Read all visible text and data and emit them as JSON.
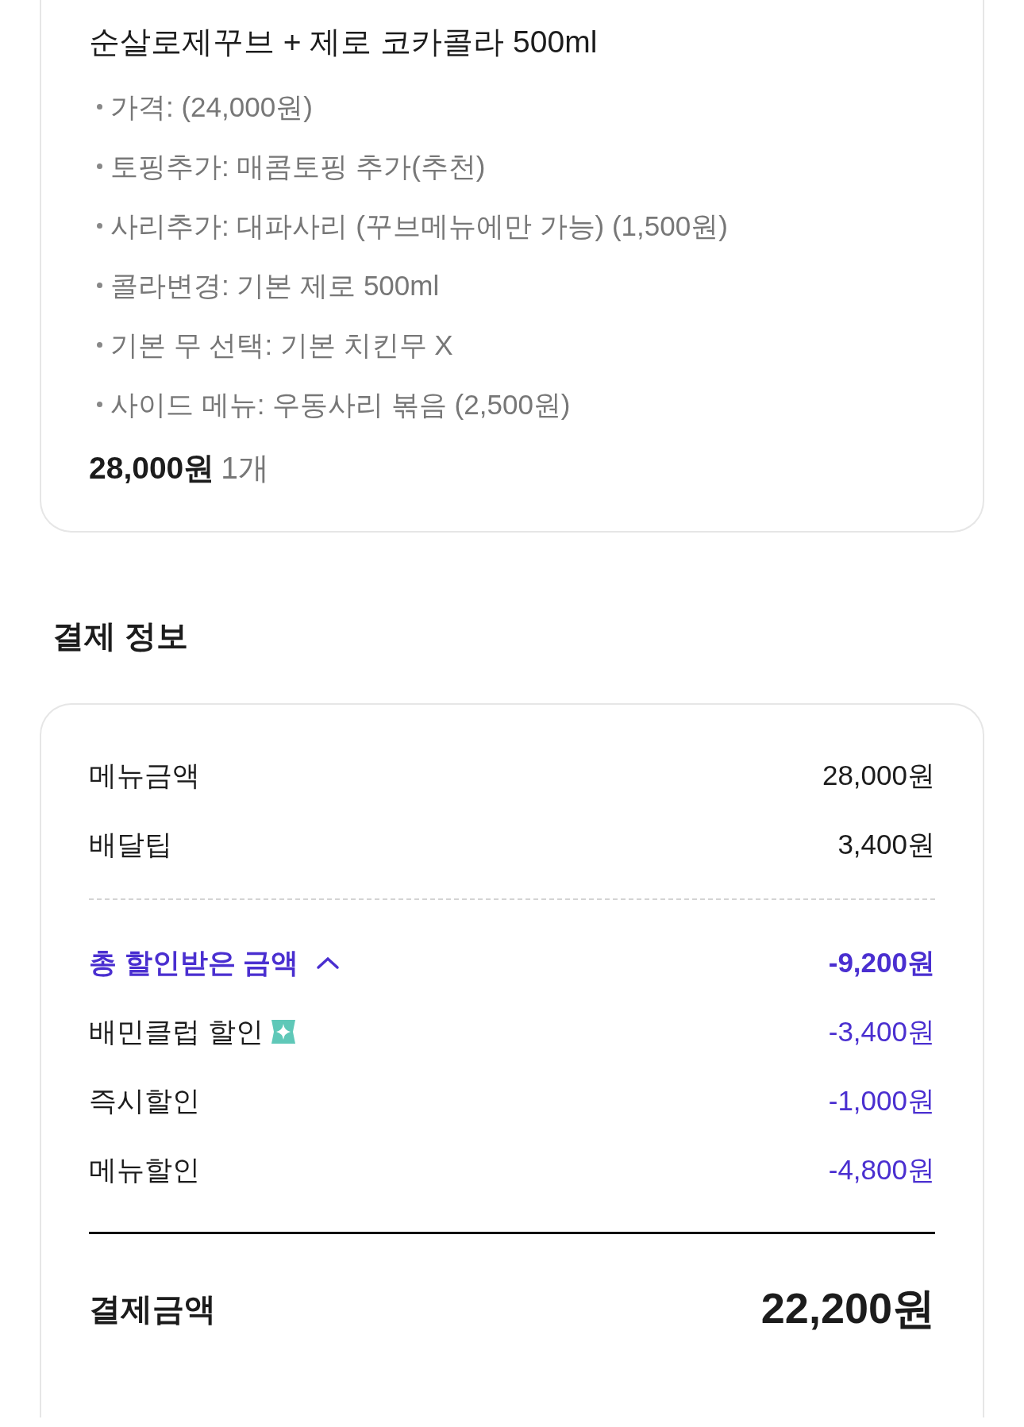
{
  "order_item": {
    "title": "순살로제꾸브 + 제로 코카콜라 500ml",
    "options": [
      "가격:  (24,000원)",
      "토핑추가: 매콤토핑 추가(추천)",
      "사리추가: 대파사리 (꾸브메뉴에만 가능) (1,500원)",
      "콜라변경: 기본 제로 500ml",
      "기본 무 선택: 기본 치킨무 X",
      "사이드 메뉴: 우동사리 볶음 (2,500원)"
    ],
    "price": "28,000원",
    "quantity": "1개"
  },
  "payment_info": {
    "title": "결제 정보",
    "rows": [
      {
        "label": "메뉴금액",
        "amount": "28,000원"
      },
      {
        "label": "배달팁",
        "amount": "3,400원"
      }
    ],
    "discount": {
      "label": "총 할인받은 금액",
      "expanded": true,
      "amount": "-9,200원",
      "items": [
        {
          "label": "배민클럽 할인",
          "amount": "-3,400원",
          "kind": "club"
        },
        {
          "label": "즉시할인",
          "amount": "-1,000원",
          "kind": "plain"
        },
        {
          "label": "메뉴할인",
          "amount": "-4,800원",
          "kind": "plain"
        }
      ]
    },
    "total": {
      "label": "결제금액",
      "amount": "22,200원"
    }
  }
}
